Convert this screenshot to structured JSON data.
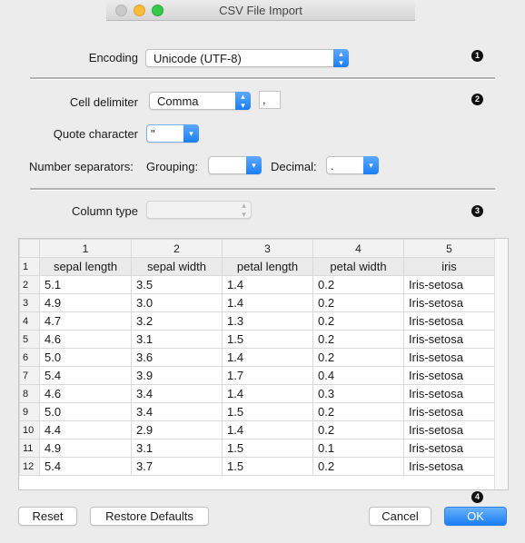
{
  "window": {
    "title": "CSV File Import"
  },
  "section1": {
    "encoding_label": "Encoding",
    "encoding_value": "Unicode (UTF-8)",
    "badge": "1"
  },
  "section2": {
    "badge": "2",
    "cell_delimiter_label": "Cell delimiter",
    "cell_delimiter_value": "Comma",
    "cell_delimiter_char": ",",
    "quote_label": "Quote character",
    "quote_value": "\"",
    "number_sep_label": "Number separators:",
    "grouping_label": "Grouping:",
    "grouping_value": "",
    "decimal_label": "Decimal:",
    "decimal_value": "."
  },
  "section3": {
    "badge": "3",
    "column_type_label": "Column type",
    "column_type_value": ""
  },
  "table": {
    "column_numbers": [
      "1",
      "2",
      "3",
      "4",
      "5"
    ],
    "rows": [
      [
        "1",
        "sepal length",
        "sepal width",
        "petal length",
        "petal width",
        "iris"
      ],
      [
        "2",
        "5.1",
        "3.5",
        "1.4",
        "0.2",
        "Iris-setosa"
      ],
      [
        "3",
        "4.9",
        "3.0",
        "1.4",
        "0.2",
        "Iris-setosa"
      ],
      [
        "4",
        "4.7",
        "3.2",
        "1.3",
        "0.2",
        "Iris-setosa"
      ],
      [
        "5",
        "4.6",
        "3.1",
        "1.5",
        "0.2",
        "Iris-setosa"
      ],
      [
        "6",
        "5.0",
        "3.6",
        "1.4",
        "0.2",
        "Iris-setosa"
      ],
      [
        "7",
        "5.4",
        "3.9",
        "1.7",
        "0.4",
        "Iris-setosa"
      ],
      [
        "8",
        "4.6",
        "3.4",
        "1.4",
        "0.3",
        "Iris-setosa"
      ],
      [
        "9",
        "5.0",
        "3.4",
        "1.5",
        "0.2",
        "Iris-setosa"
      ],
      [
        "10",
        "4.4",
        "2.9",
        "1.4",
        "0.2",
        "Iris-setosa"
      ],
      [
        "11",
        "4.9",
        "3.1",
        "1.5",
        "0.1",
        "Iris-setosa"
      ],
      [
        "12",
        "5.4",
        "3.7",
        "1.5",
        "0.2",
        "Iris-setosa"
      ]
    ]
  },
  "footer": {
    "badge": "4",
    "reset_label": "Reset",
    "restore_label": "Restore Defaults",
    "cancel_label": "Cancel",
    "ok_label": "OK"
  }
}
